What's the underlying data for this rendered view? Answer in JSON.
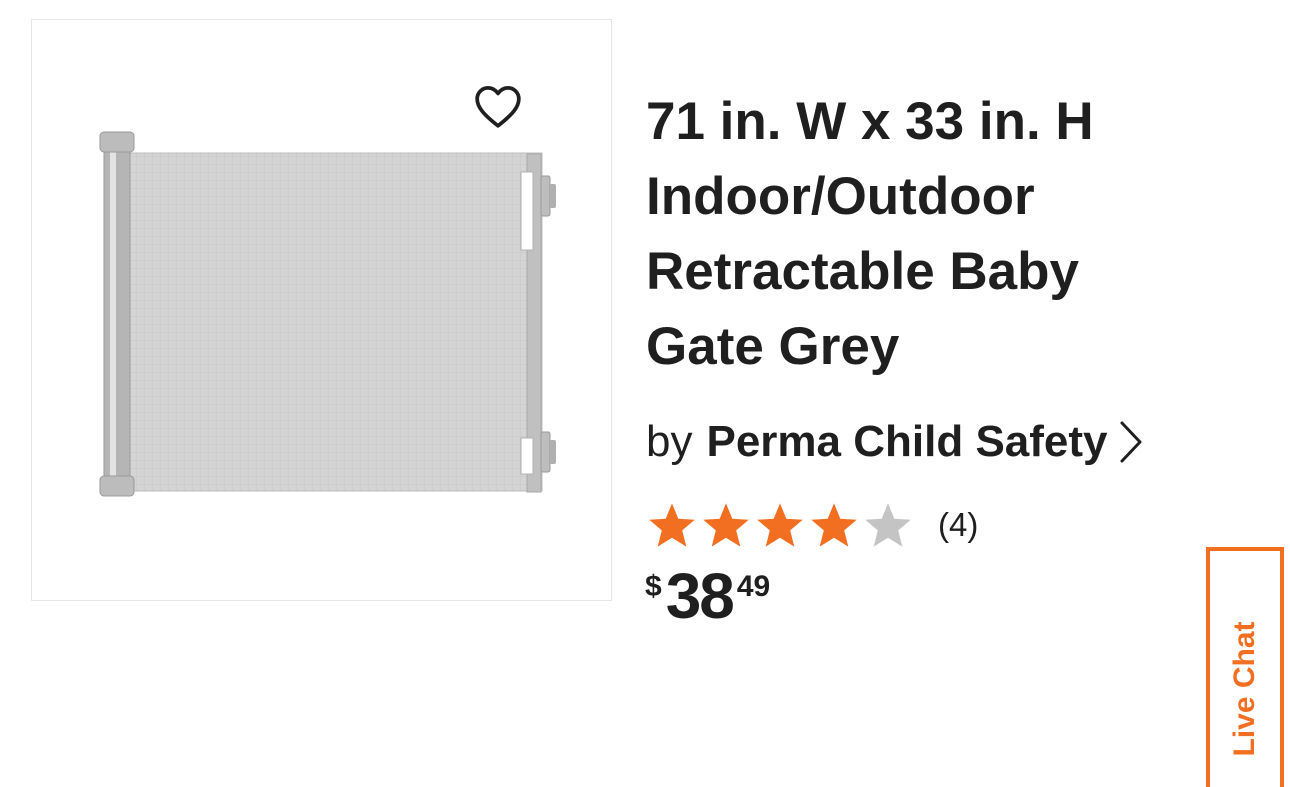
{
  "product": {
    "title": "71 in. W x 33 in. H Indoor/Outdoor Retractable Baby Gate Grey",
    "by_label": "by",
    "brand": "Perma Child Safety",
    "rating": {
      "value": 4,
      "max": 5,
      "count_text": "(4)"
    },
    "price": {
      "currency": "$",
      "dollars": "38",
      "cents": "49"
    }
  },
  "icons": {
    "favorite": "heart-outline-icon",
    "brand_link": "chevron-right-icon",
    "star_filled": "star-filled-icon",
    "star_empty": "star-empty-icon"
  },
  "colors": {
    "accent": "#f26f22",
    "star_empty": "#c4c4c4",
    "text": "#1f1f1f"
  },
  "live_chat": {
    "label": "Live Chat"
  }
}
